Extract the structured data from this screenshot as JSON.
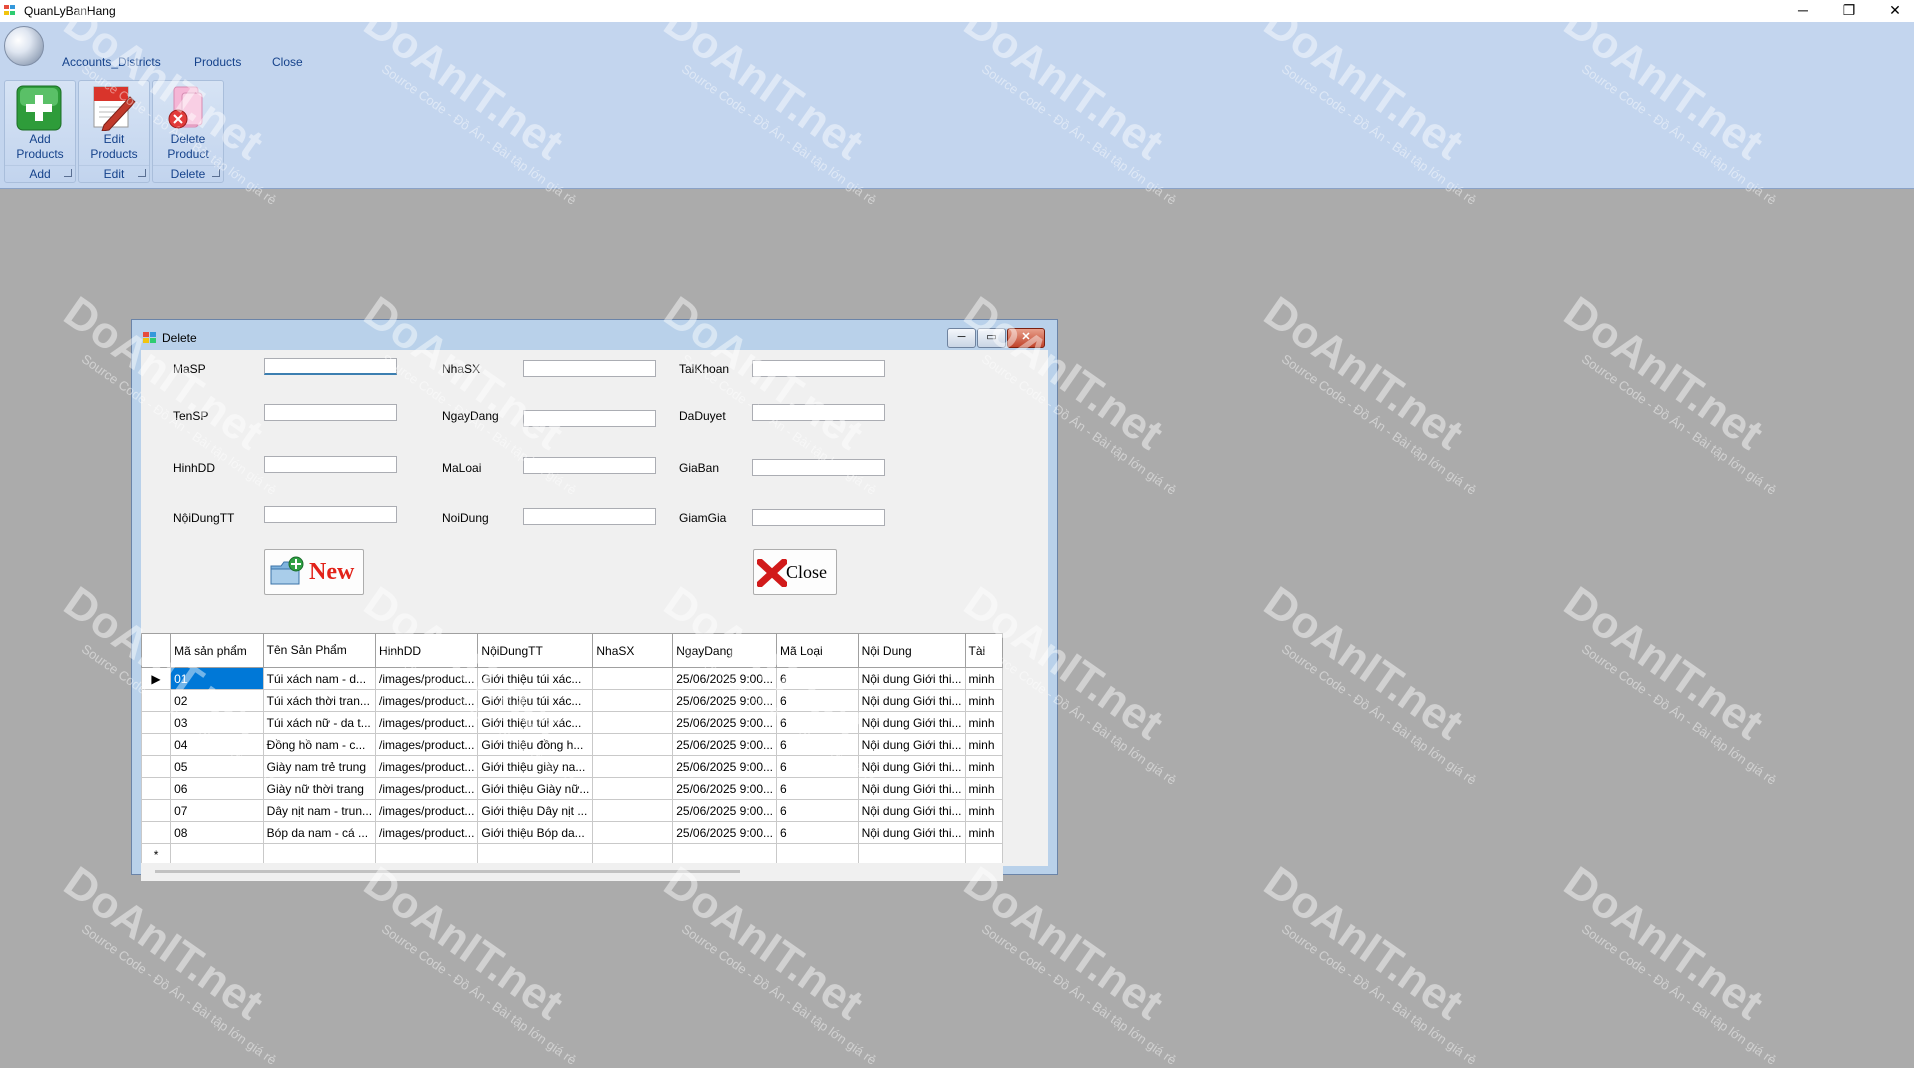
{
  "app": {
    "title": "QuanLyBanHang"
  },
  "ribbon": {
    "tabs": [
      "Accounts_Districts",
      "Products",
      "Close"
    ],
    "buttons": [
      {
        "label_line1": "Add",
        "label_line2": "Products",
        "group": "Add"
      },
      {
        "label_line1": "Edit",
        "label_line2": "Products",
        "group": "Edit"
      },
      {
        "label_line1": "Delete",
        "label_line2": "Product",
        "group": "Delete"
      }
    ]
  },
  "form": {
    "title": "Delete",
    "labels": {
      "masp": "MaSP",
      "tensp": "TenSP",
      "hinhdd": "HinhDD",
      "noidungtt": "NộiDungTT",
      "nhasx": "NhaSX",
      "ngaydang": "NgayDang",
      "maloai": "MaLoai",
      "noidung": "NoiDung",
      "taikhoan": "TaiKhoan",
      "daduyet": "DaDuyet",
      "giaban": "GiaBan",
      "giamgia": "GiamGia"
    },
    "new_button": "New",
    "close_button": "Close"
  },
  "grid": {
    "columns": [
      "Mã sản phẩm",
      "Tên Sản Phẩm",
      "HinhDD",
      "NộiDungTT",
      "NhaSX",
      "NgayDang",
      "Mã Loại",
      "Nội Dung",
      "Tài"
    ],
    "rows": [
      [
        "01",
        "Túi xách nam - d...",
        "/images/product...",
        "Giới thiệu túi xác...",
        "",
        "25/06/2025 9:00...",
        "6",
        "Nội dung Giới thi...",
        "minh"
      ],
      [
        "02",
        "Túi xách thời tran...",
        "/images/product...",
        "Giới thiệu túi xác...",
        "",
        "25/06/2025 9:00...",
        "6",
        "Nội dung Giới thi...",
        "minh"
      ],
      [
        "03",
        "Túi xách nữ - da t...",
        "/images/product...",
        "Giới thiệu túi xác...",
        "",
        "25/06/2025 9:00...",
        "6",
        "Nội dung Giới thi...",
        "minh"
      ],
      [
        "04",
        "Đồng hồ nam - c...",
        "/images/product...",
        "Giới thiệu đồng h...",
        "",
        "25/06/2025 9:00...",
        "6",
        "Nội dung Giới thi...",
        "minh"
      ],
      [
        "05",
        "Giày nam trẻ trung",
        "/images/product...",
        "Giới thiệu giày na...",
        "",
        "25/06/2025 9:00...",
        "6",
        "Nội dung Giới thi...",
        "minh"
      ],
      [
        "06",
        "Giày nữ thời trang",
        "/images/product...",
        "Giới thiệu Giày nữ...",
        "",
        "25/06/2025 9:00...",
        "6",
        "Nội dung Giới thi...",
        "minh"
      ],
      [
        "07",
        "Dây nịt nam - trun...",
        "/images/product...",
        "Giới thiệu Dây nịt ...",
        "",
        "25/06/2025 9:00...",
        "6",
        "Nội dung Giới thi...",
        "minh"
      ],
      [
        "08",
        "Bóp da nam - cá ...",
        "/images/product...",
        "Giới thiệu Bóp da...",
        "",
        "25/06/2025 9:00...",
        "6",
        "Nội dung Giới thi...",
        "minh"
      ]
    ],
    "new_row_marker": "*",
    "current_row_marker": "▶"
  },
  "watermark": {
    "brand": "DoAnIT.net",
    "tagline": "Source Code - Đồ Án - Bài tập lớn giá rẻ"
  },
  "colors": {
    "ribbon": "#c3d5ee",
    "selection": "#0078d7",
    "desktop": "#ababab"
  }
}
